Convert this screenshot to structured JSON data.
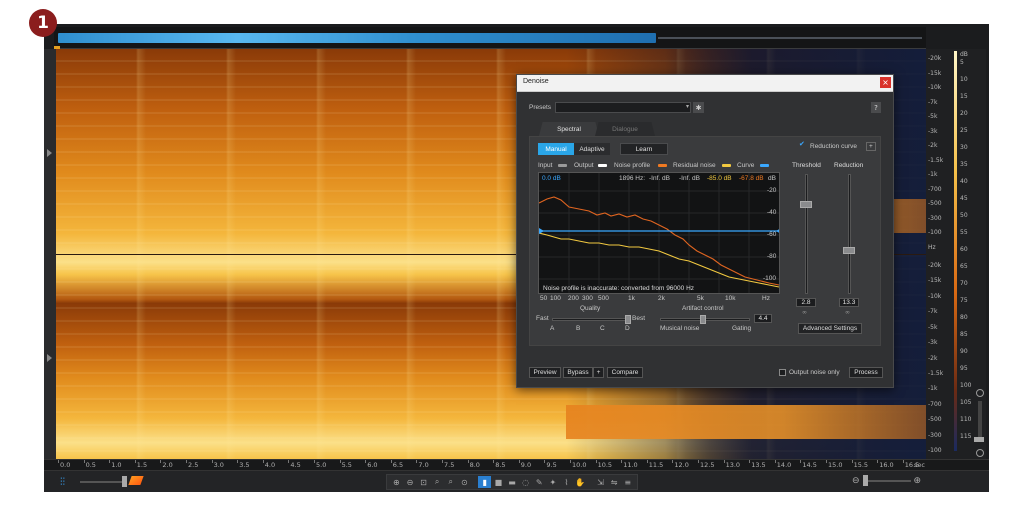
{
  "step_badge": "1",
  "dialog": {
    "title": "Denoise",
    "close_glyph": "×",
    "presets_label": "Presets",
    "presets_value": "",
    "help_glyph": "?",
    "tabs": [
      "Spectral",
      "Dialogue"
    ],
    "mode_buttons": [
      "Manual",
      "Adaptive"
    ],
    "active_mode": "Manual",
    "learn_label": "Learn",
    "reduction_curve_label": "Reduction curve",
    "reduction_curve_checked": true,
    "legend": [
      {
        "label": "Input",
        "color": "#9a9a9a"
      },
      {
        "label": "Output",
        "color": "#ffffff"
      },
      {
        "label": "Noise profile",
        "color": "#f07a22"
      },
      {
        "label": "Residual noise",
        "color": "#f2c940"
      },
      {
        "label": "Curve",
        "color": "#3aa8ff"
      }
    ],
    "graph": {
      "readout_left": "0.0 dB",
      "readout_freq": "1896 Hz:",
      "readout_values": [
        "-Inf. dB",
        "-Inf. dB",
        "-85.0 dB",
        "-67.8 dB"
      ],
      "readout_colors": [
        "#c8c8c8",
        "#c8c8c8",
        "#f2c940",
        "#f07a22"
      ],
      "db_unit": "dB",
      "y_ticks": [
        "-20",
        "-40",
        "-60",
        "-80",
        "-100"
      ],
      "x_ticks": [
        "50",
        "100",
        "200",
        "300",
        "500",
        "1k",
        "2k",
        "5k",
        "10k",
        "Hz"
      ],
      "warning": "Noise profile is inaccurate: converted from 96000 Hz"
    },
    "threshold_label": "Threshold",
    "threshold_value": "2.8",
    "reduction_label": "Reduction",
    "reduction_value": "13.3",
    "advanced_label": "Advanced Settings",
    "quality_label": "Quality",
    "quality_fast": "Fast",
    "quality_best": "Best",
    "quality_marks": [
      "A",
      "B",
      "C",
      "D"
    ],
    "artifact_label": "Artifact control",
    "artifact_value": "4.4",
    "artifact_left": "Musical noise",
    "artifact_right": "Gating",
    "preview_label": "Preview",
    "bypass_label": "Bypass",
    "bypass_plus": "+",
    "compare_label": "Compare",
    "output_noise_label": "Output noise only",
    "process_label": "Process"
  },
  "freq_axis": {
    "unit_top": "Hz",
    "top_labels": [
      "-20k",
      "-15k",
      "-10k",
      "-7k",
      "-5k",
      "-3k",
      "-2k",
      "-1.5k",
      "-1k",
      "-700",
      "-500",
      "-300",
      "-100",
      "Hz"
    ],
    "bottom_labels": [
      "-20k",
      "-15k",
      "-10k",
      "-7k",
      "-5k",
      "-3k",
      "-2k",
      "-1.5k",
      "-1k",
      "-700",
      "-500",
      "-300",
      "-100"
    ]
  },
  "db_axis": {
    "unit": "dB",
    "labels": [
      "5",
      "10",
      "15",
      "20",
      "25",
      "30",
      "35",
      "40",
      "45",
      "50",
      "55",
      "60",
      "65",
      "70",
      "75",
      "80",
      "85",
      "90",
      "95",
      "100",
      "105",
      "110",
      "115"
    ]
  },
  "time_ruler": {
    "labels": [
      "0.0",
      "0.5",
      "1.0",
      "1.5",
      "2.0",
      "2.5",
      "3.0",
      "3.5",
      "4.0",
      "4.5",
      "5.0",
      "5.5",
      "6.0",
      "6.5",
      "7.0",
      "7.5",
      "8.0",
      "8.5",
      "9.0",
      "9.5",
      "10.0",
      "10.5",
      "11.0",
      "11.5",
      "12.0",
      "12.5",
      "13.0",
      "13.5",
      "14.0",
      "14.5",
      "15.0",
      "15.5",
      "16.0",
      "16.5"
    ],
    "unit": "sec"
  },
  "colors": {
    "accent": "#2aa6e8",
    "noise_profile": "#f07a22",
    "residual_noise": "#f2c940",
    "curve": "#3aa8ff"
  }
}
